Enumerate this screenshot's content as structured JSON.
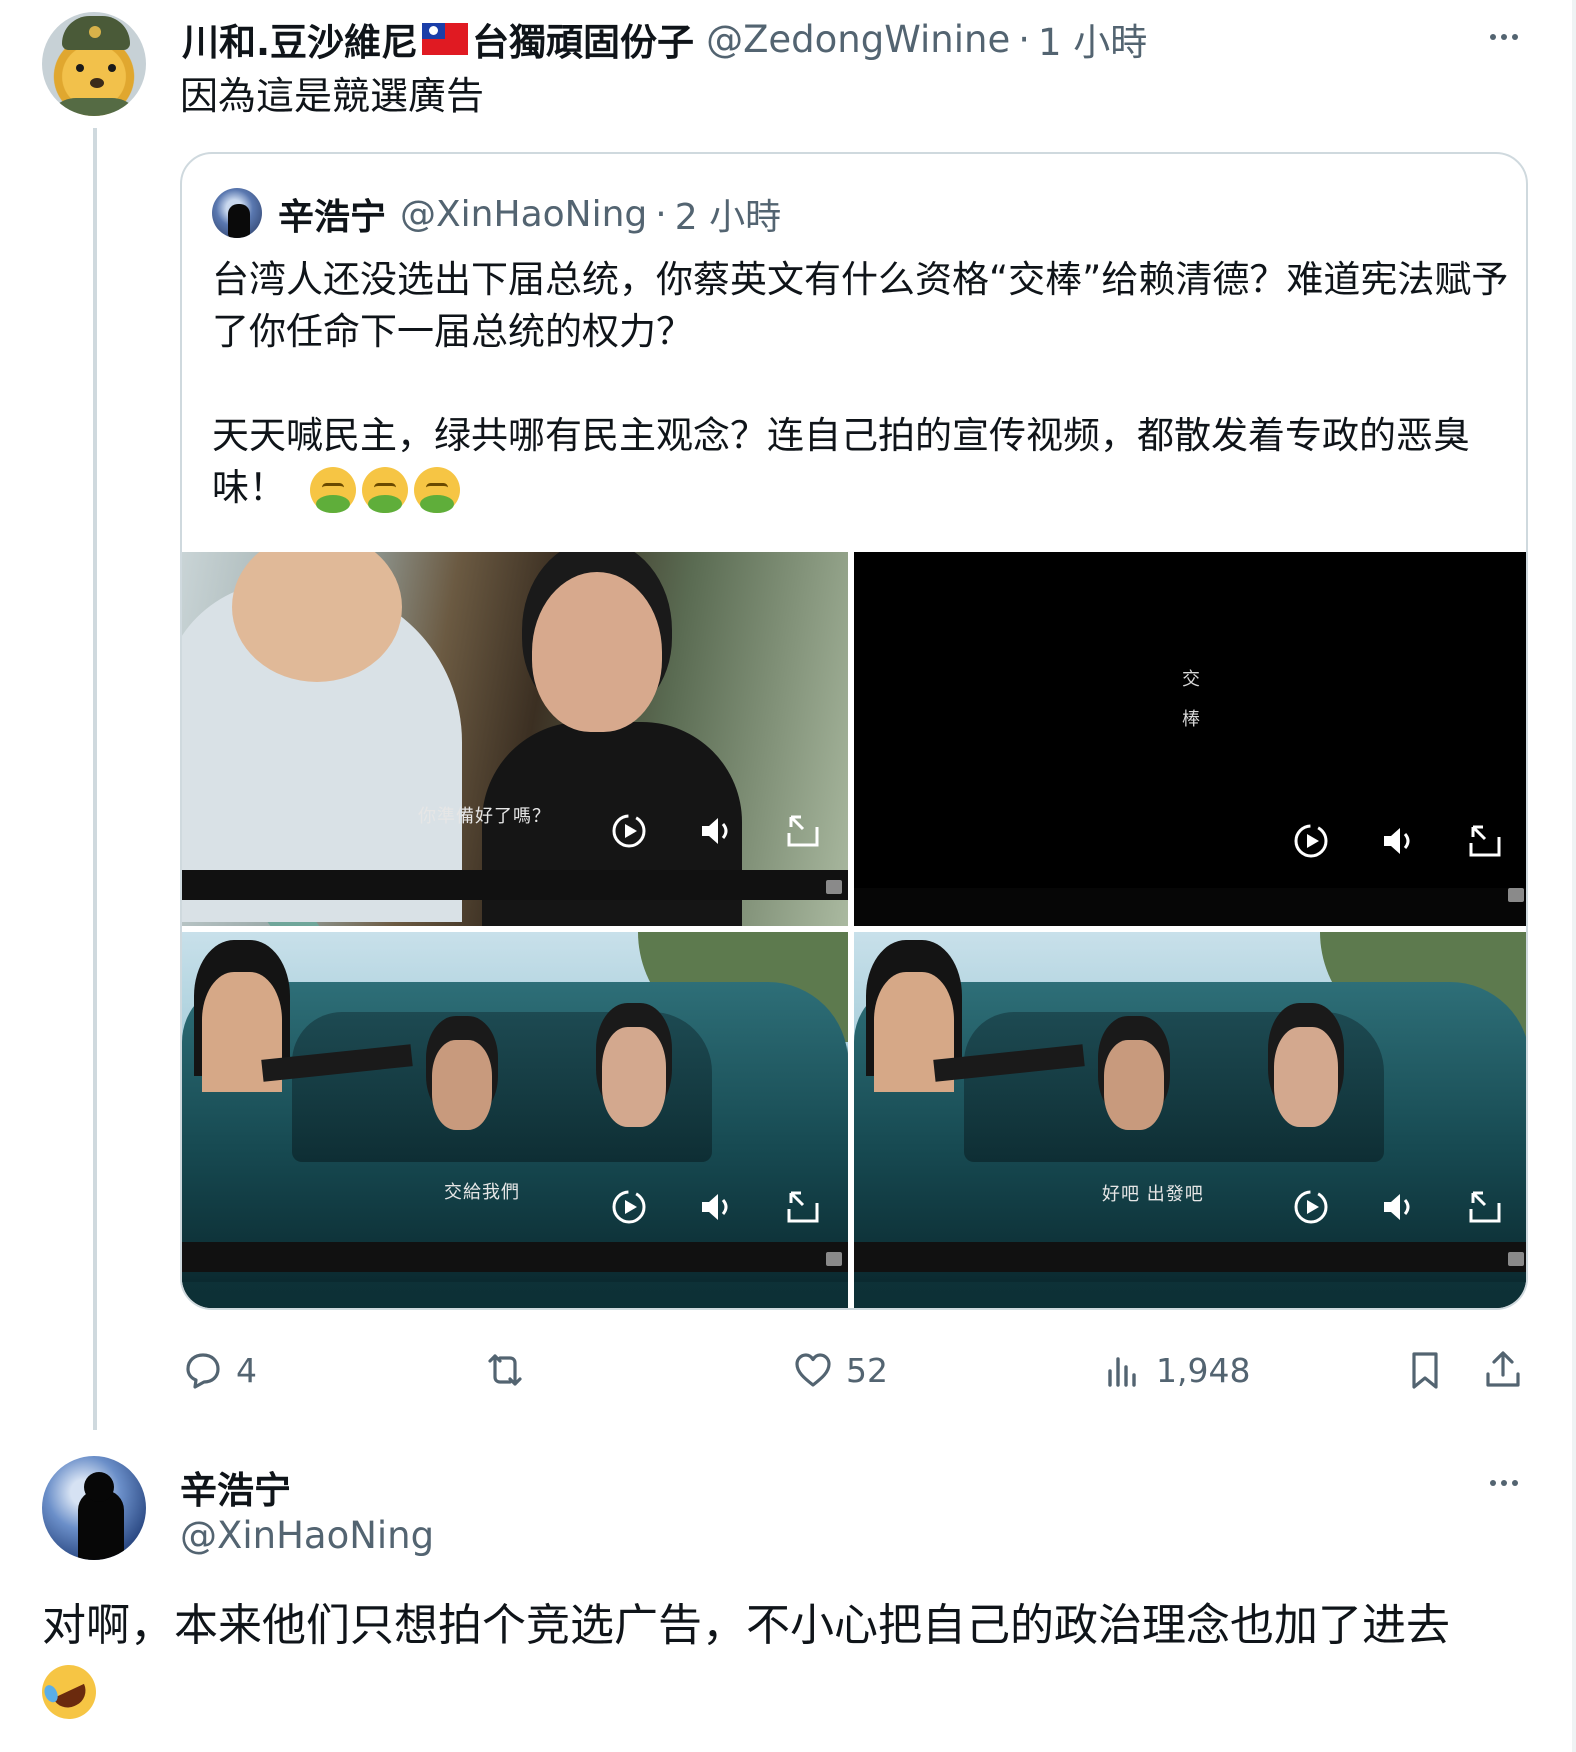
{
  "tweet1": {
    "author_name": "川和.豆沙維尼",
    "author_name_suffix": "台獨頑固份子",
    "flag_icon": "taiwan-flag-icon",
    "handle": "@ZedongWinine",
    "separator": "·",
    "time": "1 小時",
    "text": "因為這是競選廣告"
  },
  "quote": {
    "author_name": "辛浩宁",
    "handle": "@XinHaoNing",
    "separator": "·",
    "time": "2 小時",
    "text": "台湾人还没选出下届总统，你蔡英文有什么资格“交棒”给赖清德？难道宪法赋予了你任命下一届总统的权力？\n\n天天喊民主，绿共哪有民主观念？连自己拍的宣传视频，都散发着专政的恶臭味！",
    "emojis": [
      "nauseated-face-emoji",
      "nauseated-face-emoji",
      "nauseated-face-emoji"
    ],
    "videos": [
      {
        "subtitle": "你準備好了嗎？"
      },
      {
        "overlay_chars": [
          "交",
          "棒"
        ]
      },
      {
        "subtitle": "交給我們"
      },
      {
        "subtitle": "好吧 出發吧"
      }
    ]
  },
  "actions": {
    "reply_count": "4",
    "retweet_count": "",
    "like_count": "52",
    "view_count": "1,948"
  },
  "tweet2": {
    "author_name": "辛浩宁",
    "handle": "@XinHaoNing",
    "text": "对啊，本来他们只想拍个竞选广告，不小心把自己的政治理念也加了进去",
    "emoji": "rolling-on-the-floor-laughing-emoji"
  },
  "colors": {
    "text_primary": "#0f1419",
    "text_secondary": "#536471",
    "border": "#cfd9de",
    "flag_red": "#e01a22",
    "flag_blue": "#1b3ea8"
  }
}
